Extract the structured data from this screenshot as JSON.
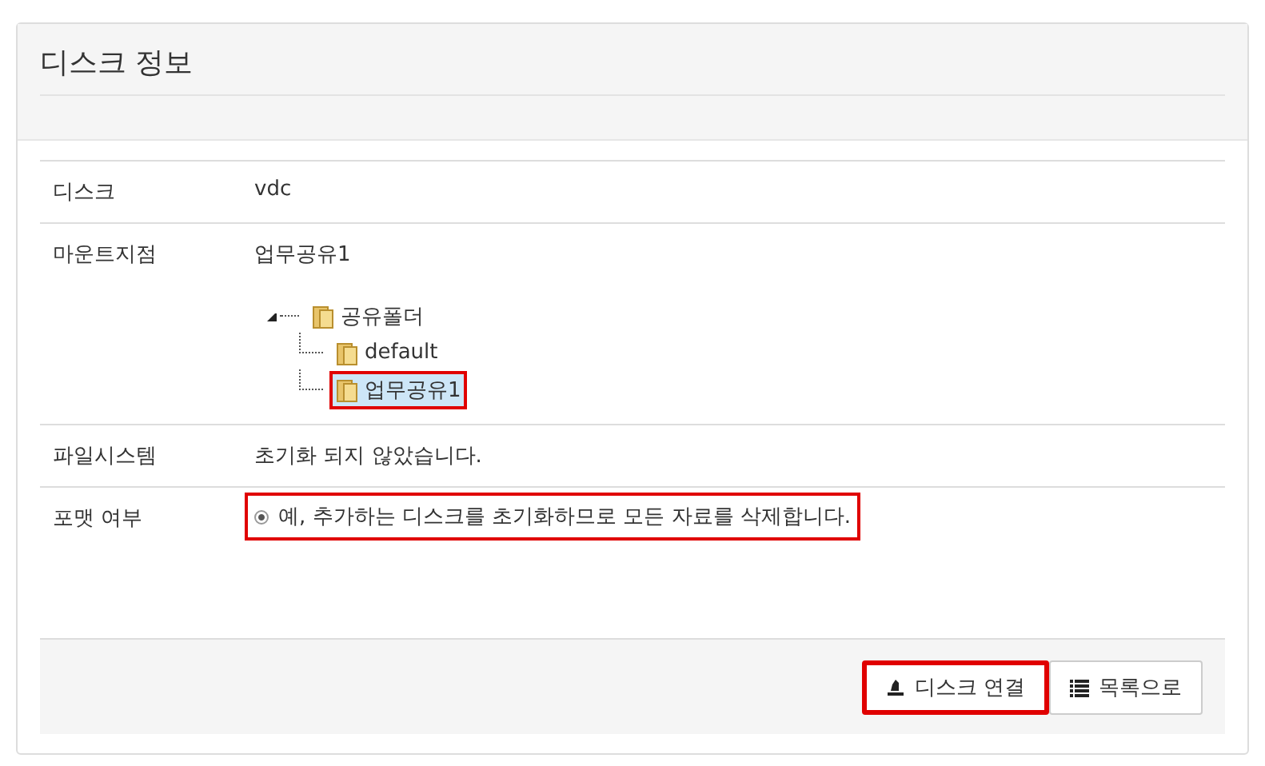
{
  "panel": {
    "title": "디스크 정보"
  },
  "rows": [
    {
      "kind": "text",
      "label": "디스크",
      "value": "vdc"
    },
    {
      "kind": "tree",
      "label": "마운트지점",
      "value": "업무공유1",
      "tree": [
        {
          "label": "공유폴더",
          "expanded": true,
          "selected": false,
          "highlighted": false,
          "children": [
            {
              "label": "default",
              "selected": false,
              "highlighted": false
            },
            {
              "label": "업무공유1",
              "selected": true,
              "highlighted": true
            }
          ]
        }
      ]
    },
    {
      "kind": "text",
      "label": "파일시스템",
      "value": "초기화 되지 않았습니다."
    },
    {
      "kind": "radio",
      "label": "포맷 여부",
      "option": {
        "label": "예, 추가하는 디스크를 초기화하므로 모든 자료를 삭제합니다.",
        "selected": true,
        "highlighted": true
      }
    }
  ],
  "buttons": [
    {
      "kind": "connect",
      "label": "디스크 연결",
      "highlighted": true
    },
    {
      "kind": "list",
      "label": "목록으로",
      "highlighted": false
    }
  ]
}
